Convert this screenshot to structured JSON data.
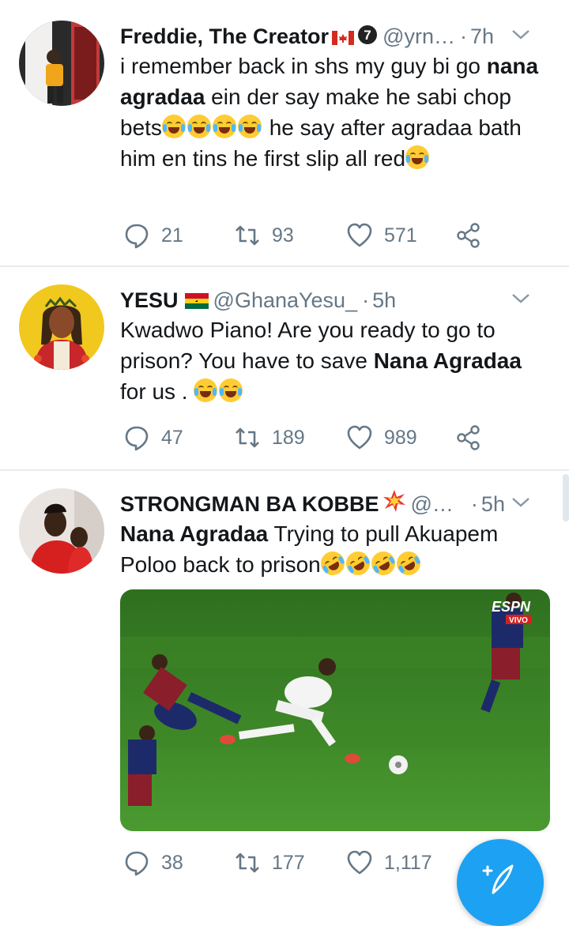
{
  "tweets": [
    {
      "name": "Freddie, The Creator",
      "flag": "canada-flag",
      "badge": "7",
      "handle": "@yrn…",
      "time": "7h",
      "text_parts": [
        {
          "t": "i remember back in shs my guy bi go ",
          "b": false
        },
        {
          "t": "nana agradaa",
          "b": true
        },
        {
          "t": " ein der say make he sabi chop bets",
          "b": false
        }
      ],
      "text_after_emoji": " he say after agradaa bath him en tins he first slip all red",
      "reply_count": "21",
      "retweet_count": "93",
      "like_count": "571"
    },
    {
      "name": "YESU",
      "flag": "ghana-flag",
      "handle": "@GhanaYesu_",
      "time": "5h",
      "text_a": "Kwadwo Piano! Are you ready to go to prison? You have to save ",
      "text_bold": "Nana Agradaa",
      "text_b": " for us . ",
      "reply_count": "47",
      "retweet_count": "189",
      "like_count": "989"
    },
    {
      "name": "STRONGMAN BA KOBBE",
      "handle": "@…",
      "time": "5h",
      "text_bold": "Nana Agradaa",
      "text_a": " Trying to pull Akuapem Poloo back to prison",
      "media_badge": "ESPN",
      "media_sub": "VIVO",
      "reply_count": "38",
      "retweet_count": "177",
      "like_count": "1,117"
    }
  ],
  "separator": "·",
  "colors": {
    "accent": "#1da1f2",
    "text": "#14171a",
    "muted": "#657786",
    "divider": "#e6ecf0",
    "pitch": "#3f8a2a"
  },
  "icons": [
    "reply-icon",
    "retweet-icon",
    "like-icon",
    "share-icon",
    "caret-down-icon",
    "compose-icon"
  ]
}
